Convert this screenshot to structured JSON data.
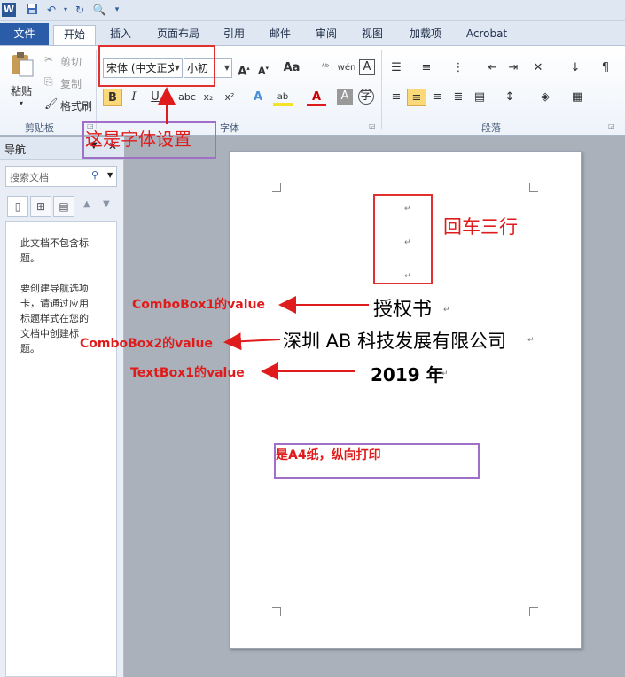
{
  "title_bar": {
    "logo": "W",
    "qat_icons": [
      "save-icon",
      "undo-icon",
      "redo-icon",
      "print-preview-icon",
      "customize-icon"
    ]
  },
  "tabs": [
    {
      "label": "文件"
    },
    {
      "label": "开始"
    },
    {
      "label": "插入"
    },
    {
      "label": "页面布局"
    },
    {
      "label": "引用"
    },
    {
      "label": "邮件"
    },
    {
      "label": "审阅"
    },
    {
      "label": "视图"
    },
    {
      "label": "加载项"
    },
    {
      "label": "Acrobat"
    }
  ],
  "ribbon": {
    "clipboard": {
      "paste_label": "粘贴",
      "cut_label": "剪切",
      "copy_label": "复制",
      "format_painter_label": "格式刷",
      "group_label": "剪贴板"
    },
    "font": {
      "font_name_value": "宋体 (中文正文",
      "font_size_value": "小初",
      "group_label": "字体"
    },
    "paragraph": {
      "group_label": "段落"
    }
  },
  "nav_pane": {
    "title": "导航",
    "search_placeholder": "搜索文档",
    "empty_line1": "此文档不包含标题。",
    "empty_line2": "要创建导航选项卡，请通过应用标题样式在您的文档中创建标题。"
  },
  "document": {
    "para_mark": "↵",
    "line1": "授权书",
    "line2": "深圳 AB 科技发展有限公司",
    "line3": "2019 年"
  },
  "annotations": {
    "font_setting": "这是字体设置",
    "enter_three_lines": "回车三行",
    "combobox1": "ComboBox1的value",
    "combobox2": "ComboBox2的value",
    "textbox1": "TextBox1的value",
    "paper": "是A4纸，纵向打印"
  },
  "colors": {
    "accent": "#2a5ca8",
    "annotation_red": "#e01b1b",
    "annotation_purple": "#a070c8"
  }
}
